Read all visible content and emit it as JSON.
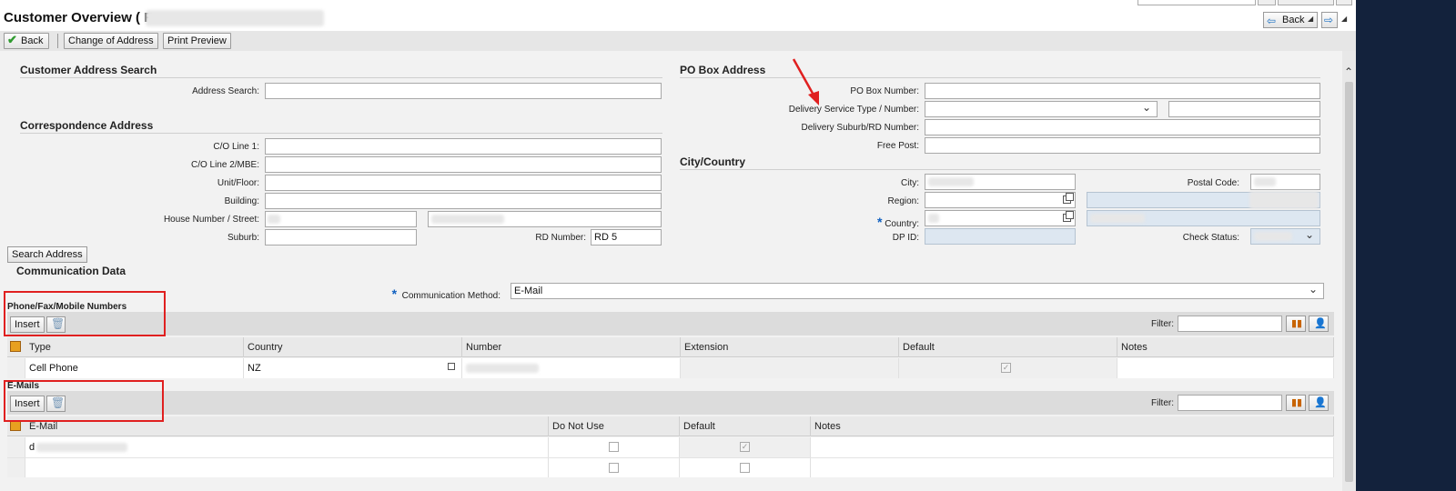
{
  "window": {
    "title": "Customer Overview ( F"
  },
  "top_right": {
    "back_label": "Back"
  },
  "toolbar": {
    "back_label": "Back",
    "change_address_label": "Change of Address",
    "print_preview_label": "Print Preview"
  },
  "address_search": {
    "header": "Customer Address Search",
    "address_search_label": "Address Search:",
    "address_search_value": ""
  },
  "correspondence": {
    "header": "Correspondence Address",
    "co_line1_label": "C/O Line 1:",
    "co_line2_label": "C/O Line 2/MBE:",
    "unit_floor_label": "Unit/Floor:",
    "building_label": "Building:",
    "house_street_label": "House Number / Street:",
    "suburb_label": "Suburb:",
    "rd_number_label": "RD Number:",
    "rd_number_value": "RD 5",
    "search_address_label": "Search Address"
  },
  "po_box": {
    "header": "PO Box Address",
    "po_box_number_label": "PO Box Number:",
    "delivery_service_label": "Delivery Service Type / Number:",
    "delivery_suburb_label": "Delivery Suburb/RD Number:",
    "free_post_label": "Free Post:"
  },
  "city_country": {
    "header": "City/Country",
    "city_label": "City:",
    "postal_code_label": "Postal Code:",
    "region_label": "Region:",
    "country_label": "Country:",
    "dp_id_label": "DP ID:",
    "check_status_label": "Check Status:"
  },
  "communication": {
    "header": "Communication Data",
    "method_label": "Communication Method:",
    "method_value": "E-Mail"
  },
  "phones": {
    "header": "Phone/Fax/Mobile Numbers",
    "insert_label": "Insert",
    "filter_label": "Filter:",
    "columns": [
      "Type",
      "Country",
      "Number",
      "Extension",
      "Default",
      "Notes"
    ],
    "rows": [
      {
        "type": "Cell Phone",
        "country": "NZ"
      }
    ]
  },
  "emails": {
    "header": "E-Mails",
    "insert_label": "Insert",
    "filter_label": "Filter:",
    "columns": [
      "E-Mail",
      "Do Not Use",
      "Default",
      "Notes"
    ],
    "rows": [
      {
        "email": "d"
      }
    ]
  },
  "colors": {
    "accent_red": "#e02020",
    "readonly_blue": "#dde7f1"
  }
}
